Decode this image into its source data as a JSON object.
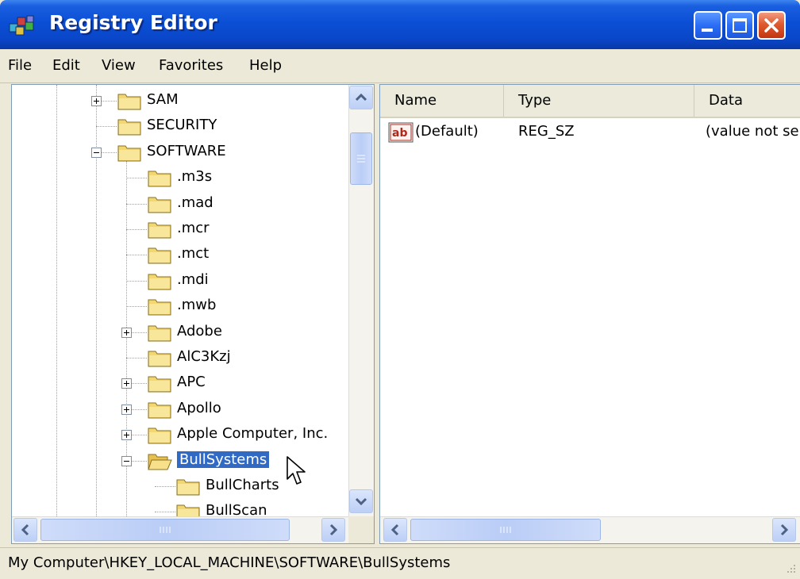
{
  "window": {
    "title": "Registry Editor"
  },
  "menu": [
    "File",
    "Edit",
    "View",
    "Favorites",
    "Help"
  ],
  "tree": {
    "items": [
      {
        "label": "SAM",
        "level": 1,
        "expander": "plus"
      },
      {
        "label": "SECURITY",
        "level": 1,
        "expander": "none"
      },
      {
        "label": "SOFTWARE",
        "level": 1,
        "expander": "minus"
      },
      {
        "label": ".m3s",
        "level": 2,
        "expander": "none"
      },
      {
        "label": ".mad",
        "level": 2,
        "expander": "none"
      },
      {
        "label": ".mcr",
        "level": 2,
        "expander": "none"
      },
      {
        "label": ".mct",
        "level": 2,
        "expander": "none"
      },
      {
        "label": ".mdi",
        "level": 2,
        "expander": "none"
      },
      {
        "label": ".mwb",
        "level": 2,
        "expander": "none"
      },
      {
        "label": "Adobe",
        "level": 2,
        "expander": "plus"
      },
      {
        "label": "AlC3Kzj",
        "level": 2,
        "expander": "none"
      },
      {
        "label": "APC",
        "level": 2,
        "expander": "plus"
      },
      {
        "label": "Apollo",
        "level": 2,
        "expander": "plus"
      },
      {
        "label": "Apple Computer, Inc.",
        "level": 2,
        "expander": "plus"
      },
      {
        "label": "BullSystems",
        "level": 2,
        "expander": "minus",
        "selected": true,
        "open": true
      },
      {
        "label": "BullCharts",
        "level": 3,
        "expander": "none"
      },
      {
        "label": "BullScan",
        "level": 3,
        "expander": "none"
      }
    ]
  },
  "list": {
    "columns": [
      "Name",
      "Type",
      "Data"
    ],
    "rows": [
      {
        "name": "(Default)",
        "type": "REG_SZ",
        "data": "(value not se",
        "icon": "string-value-icon"
      }
    ]
  },
  "status": {
    "path": "My Computer\\HKEY_LOCAL_MACHINE\\SOFTWARE\\BullSystems"
  },
  "colors": {
    "title_blue": "#0a46c8",
    "selection": "#316ac5",
    "close_red": "#e05a30"
  }
}
